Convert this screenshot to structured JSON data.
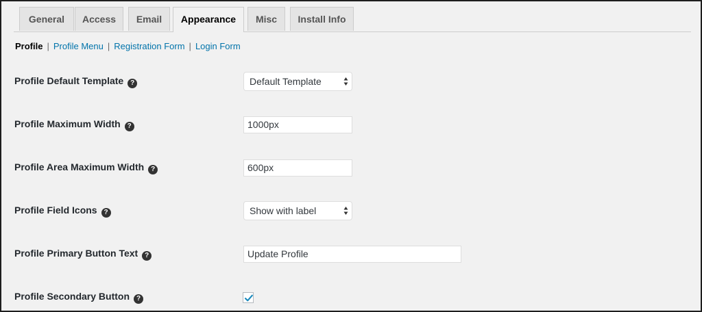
{
  "tabs": [
    {
      "label": "General",
      "active": false
    },
    {
      "label": "Access",
      "active": false
    },
    {
      "label": "Email",
      "active": false
    },
    {
      "label": "Appearance",
      "active": true
    },
    {
      "label": "Misc",
      "active": false
    },
    {
      "label": "Install Info",
      "active": false
    }
  ],
  "subnav": {
    "current": "Profile",
    "separator": "|",
    "links": [
      "Profile Menu",
      "Registration Form",
      "Login Form"
    ]
  },
  "settings": {
    "default_template": {
      "label": "Profile Default Template",
      "value": "Default Template"
    },
    "max_width": {
      "label": "Profile Maximum Width",
      "value": "1000px"
    },
    "area_max_width": {
      "label": "Profile Area Maximum Width",
      "value": "600px"
    },
    "field_icons": {
      "label": "Profile Field Icons",
      "value": "Show with label"
    },
    "primary_button_text": {
      "label": "Profile Primary Button Text",
      "value": "Update Profile"
    },
    "secondary_button": {
      "label": "Profile Secondary Button",
      "checked": true
    }
  },
  "help_glyph": "?",
  "icons": {
    "help": "question-circle-icon",
    "select_arrows": "up-down-arrows-icon",
    "check": "checkmark-icon"
  },
  "colors": {
    "link": "#0073aa",
    "checkmark": "#1e8cbe",
    "help_bg": "#333333"
  }
}
